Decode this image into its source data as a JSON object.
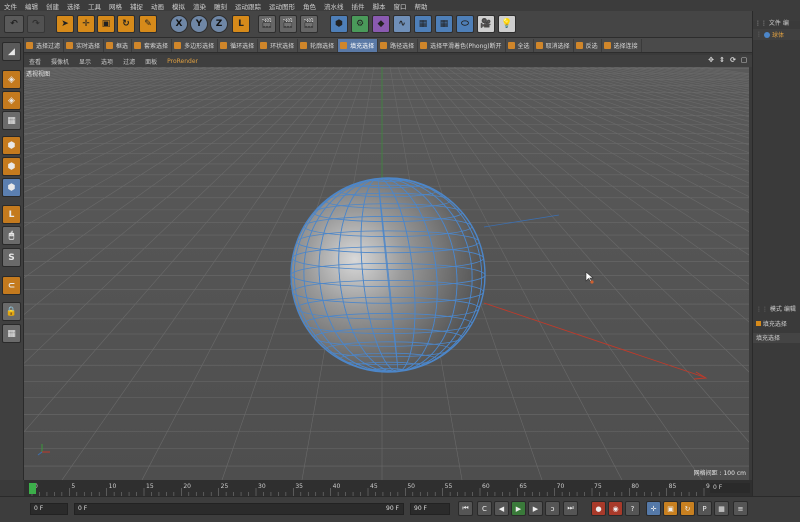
{
  "menu": [
    "文件",
    "编辑",
    "创建",
    "选择",
    "工具",
    "网格",
    "捕捉",
    "动画",
    "模拟",
    "渲染",
    "雕刻",
    "运动跟踪",
    "运动图形",
    "角色",
    "流水线",
    "插件",
    "脚本",
    "窗口",
    "帮助"
  ],
  "toolbar": {
    "undo": "↶",
    "axis": [
      "X",
      "Y",
      "Z"
    ]
  },
  "subbar": [
    "选择过滤",
    "实时选择",
    "框选",
    "套索选择",
    "多边形选择",
    "循环选择",
    "环状选择",
    "轮廓选择",
    "填充选择",
    "路径选择",
    "选择平滑着色(Phong)断开",
    "全选",
    "取消选择",
    "反选",
    "选择连接"
  ],
  "viewmenu": [
    "查看",
    "摄像机",
    "显示",
    "选项",
    "过滤",
    "面板",
    "ProRender"
  ],
  "viewport": {
    "label": "透视视图",
    "grid_info": "网格间距 : 100 cm"
  },
  "timeline": {
    "ticks": [
      "0",
      "5",
      "10",
      "15",
      "20",
      "25",
      "30",
      "35",
      "40",
      "45",
      "50",
      "55",
      "60",
      "65",
      "70",
      "75",
      "80",
      "85",
      "90"
    ],
    "current_frame_label": "0 F"
  },
  "controls": {
    "start": "0 F",
    "min": "0 F",
    "end": "90 F",
    "max": "90 F"
  },
  "rightpanel": {
    "file": "文件",
    "edit": "编",
    "object": "球体",
    "mode": "模式",
    "mode_edit": "编辑",
    "attr1": "填充选择",
    "attr2": "填充选择"
  },
  "colors": {
    "accent": "#d68a1a",
    "selection": "#5a79a6",
    "wire": "#4c86c9"
  }
}
